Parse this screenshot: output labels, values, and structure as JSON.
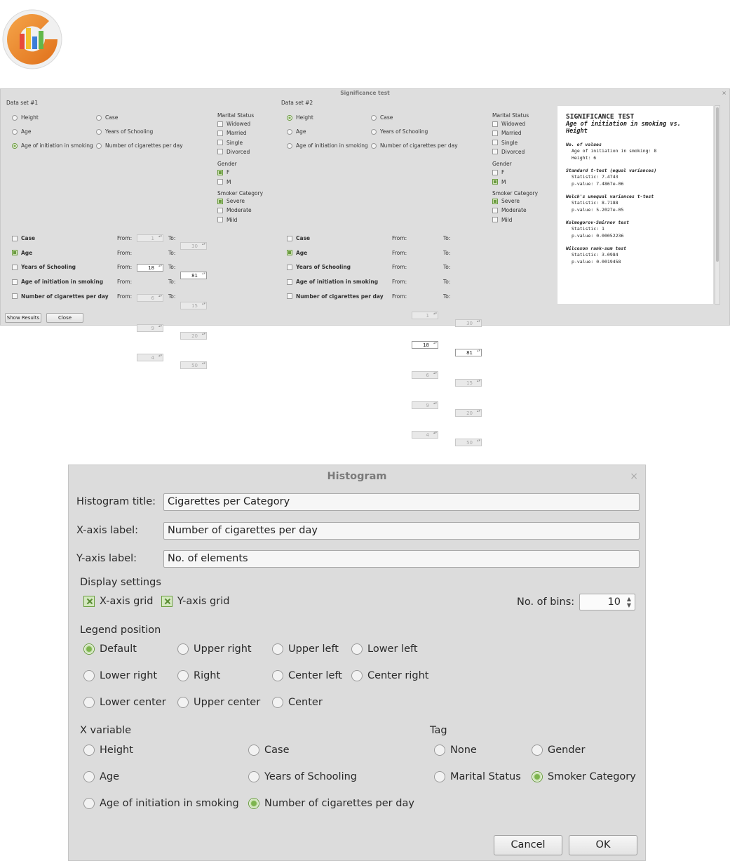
{
  "significance": {
    "title": "Significance test",
    "close": "×",
    "datasets": [
      {
        "label": "Data set #1",
        "variables": [
          {
            "label": "Height",
            "checked": false
          },
          {
            "label": "Case",
            "checked": false
          },
          {
            "label": "Age",
            "checked": false
          },
          {
            "label": "Years of Schooling",
            "checked": false
          },
          {
            "label": "Age of initiation in smoking",
            "checked": true
          },
          {
            "label": "Number of cigarettes per day",
            "checked": false
          }
        ],
        "marital_title": "Marital Status",
        "marital": [
          {
            "label": "Widowed",
            "checked": false
          },
          {
            "label": "Married",
            "checked": false
          },
          {
            "label": "Single",
            "checked": false
          },
          {
            "label": "Divorced",
            "checked": false
          }
        ],
        "gender_title": "Gender",
        "gender": [
          {
            "label": "F",
            "checked": true
          },
          {
            "label": "M",
            "checked": false
          }
        ],
        "smoker_title": "Smoker Category",
        "smoker": [
          {
            "label": "Severe",
            "checked": true
          },
          {
            "label": "Moderate",
            "checked": false
          },
          {
            "label": "Mild",
            "checked": false
          }
        ],
        "filters": [
          {
            "label": "Case",
            "checked": false,
            "from": "1",
            "to": "30"
          },
          {
            "label": "Age",
            "checked": true,
            "from": "18",
            "to": "81"
          },
          {
            "label": "Years of Schooling",
            "checked": false,
            "from": "6",
            "to": "15"
          },
          {
            "label": "Age of initiation in smoking",
            "checked": false,
            "from": "9",
            "to": "20"
          },
          {
            "label": "Number of cigarettes per day",
            "checked": false,
            "from": "4",
            "to": "50"
          }
        ]
      },
      {
        "label": "Data set #2",
        "variables": [
          {
            "label": "Height",
            "checked": true
          },
          {
            "label": "Case",
            "checked": false
          },
          {
            "label": "Age",
            "checked": false
          },
          {
            "label": "Years of Schooling",
            "checked": false
          },
          {
            "label": "Age of initiation in smoking",
            "checked": false
          },
          {
            "label": "Number of cigarettes per day",
            "checked": false
          }
        ],
        "marital_title": "Marital Status",
        "marital": [
          {
            "label": "Widowed",
            "checked": false
          },
          {
            "label": "Married",
            "checked": false
          },
          {
            "label": "Single",
            "checked": false
          },
          {
            "label": "Divorced",
            "checked": false
          }
        ],
        "gender_title": "Gender",
        "gender": [
          {
            "label": "F",
            "checked": false
          },
          {
            "label": "M",
            "checked": true
          }
        ],
        "smoker_title": "Smoker Category",
        "smoker": [
          {
            "label": "Severe",
            "checked": true
          },
          {
            "label": "Moderate",
            "checked": false
          },
          {
            "label": "Mild",
            "checked": false
          }
        ],
        "filters": [
          {
            "label": "Case",
            "checked": false,
            "from": "1",
            "to": "30"
          },
          {
            "label": "Age",
            "checked": true,
            "from": "18",
            "to": "81"
          },
          {
            "label": "Years of Schooling",
            "checked": false,
            "from": "6",
            "to": "15"
          },
          {
            "label": "Age of initiation in smoking",
            "checked": false,
            "from": "9",
            "to": "20"
          },
          {
            "label": "Number of cigarettes per day",
            "checked": false,
            "from": "4",
            "to": "50"
          }
        ]
      }
    ],
    "from_label": "From:",
    "to_label": "To:",
    "show_results": "Show Results",
    "close_button": "Close",
    "results": {
      "heading": "SIGNIFICANCE TEST",
      "subtitle": "Age of initiation in smoking vs. Height",
      "sections": [
        {
          "title": "No. of values",
          "lines": [
            "Age of initiation in smoking: 8",
            "Height: 6"
          ]
        },
        {
          "title": "Standard t-test (equal variances)",
          "lines": [
            "Statistic: 7.4743",
            "p-value: 7.4867e-06"
          ]
        },
        {
          "title": "Welch's unequal variances t-test",
          "lines": [
            "Statistic: 8.7188",
            "p-value: 5.2027e-05"
          ]
        },
        {
          "title": "Kolmogorov-Smirnov test",
          "lines": [
            "Statistic: 1",
            "p-value: 0.00052236"
          ]
        },
        {
          "title": "Wilcoxon rank-sum test",
          "lines": [
            "Statistic: 3.0984",
            "p-value: 0.0019458"
          ]
        }
      ]
    }
  },
  "histogram": {
    "title": "Histogram",
    "close": "×",
    "title_label": "Histogram title:",
    "title_value": "Cigarettes per Category",
    "xaxis_label": "X-axis label:",
    "xaxis_value": "Number of cigarettes per day",
    "yaxis_label": "Y-axis label:",
    "yaxis_value": "No. of elements",
    "display_settings": "Display settings",
    "xgrid": {
      "label": "X-axis grid",
      "checked": true
    },
    "ygrid": {
      "label": "Y-axis grid",
      "checked": true
    },
    "bins_label": "No. of bins:",
    "bins_value": "10",
    "legend_title": "Legend position",
    "legend_options": [
      {
        "label": "Default",
        "checked": true
      },
      {
        "label": "Upper right",
        "checked": false
      },
      {
        "label": "Upper left",
        "checked": false
      },
      {
        "label": "Lower left",
        "checked": false
      },
      {
        "label": "Lower right",
        "checked": false
      },
      {
        "label": "Right",
        "checked": false
      },
      {
        "label": "Center left",
        "checked": false
      },
      {
        "label": "Center right",
        "checked": false
      },
      {
        "label": "Lower center",
        "checked": false
      },
      {
        "label": "Upper center",
        "checked": false
      },
      {
        "label": "Center",
        "checked": false
      }
    ],
    "xvar_title": "X variable",
    "xvar_options": [
      {
        "label": "Height",
        "checked": false
      },
      {
        "label": "Case",
        "checked": false
      },
      {
        "label": "Age",
        "checked": false
      },
      {
        "label": "Years of Schooling",
        "checked": false
      },
      {
        "label": "Age of initiation in smoking",
        "checked": false
      },
      {
        "label": "Number of cigarettes per day",
        "checked": true
      }
    ],
    "tag_title": "Tag",
    "tag_options": [
      {
        "label": "None",
        "checked": false
      },
      {
        "label": "Gender",
        "checked": false
      },
      {
        "label": "Marital Status",
        "checked": false
      },
      {
        "label": "Smoker Category",
        "checked": true
      }
    ],
    "cancel": "Cancel",
    "ok": "OK"
  },
  "colors": {
    "accent_green": "#7db44e",
    "dialog_bg": "#dcdcdc"
  },
  "icons": {
    "logo": "app-logo-icon"
  }
}
